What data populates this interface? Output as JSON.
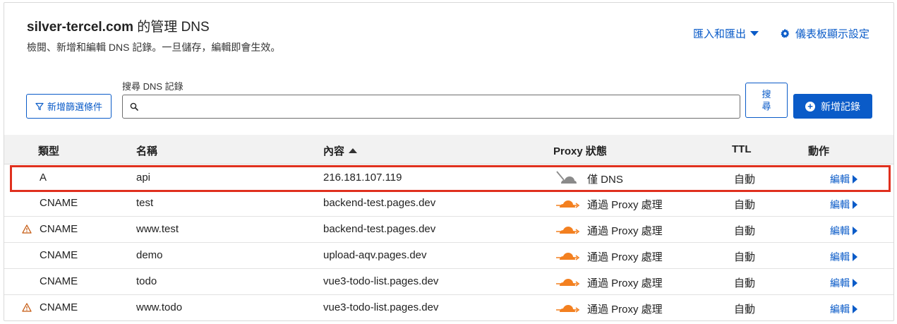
{
  "header": {
    "domain": "silver-tercel.com",
    "title_suffix": " 的管理 DNS",
    "subtitle": "檢閱、新增和編輯 DNS 記錄。一旦儲存，編輯即會生效。",
    "import_export_label": "匯入和匯出",
    "dashboard_settings_label": "儀表板顯示設定"
  },
  "toolbar": {
    "filter_label": "新增篩選條件",
    "search_label": "搜尋 DNS 記錄",
    "search_value": "",
    "search_button_label": "搜尋",
    "add_record_label": "新增記錄"
  },
  "table": {
    "columns": [
      "類型",
      "名稱",
      "內容",
      "Proxy 狀態",
      "TTL",
      "動作"
    ],
    "sorted_column": "內容",
    "rows": [
      {
        "warning": false,
        "type": "A",
        "name": "api",
        "content": "216.181.107.119",
        "proxy": "僅 DNS",
        "proxied": false,
        "ttl": "自動",
        "action": "編輯"
      },
      {
        "warning": false,
        "type": "CNAME",
        "name": "test",
        "content": "backend-test.pages.dev",
        "proxy": "通過 Proxy 處理",
        "proxied": true,
        "ttl": "自動",
        "action": "編輯"
      },
      {
        "warning": true,
        "type": "CNAME",
        "name": "www.test",
        "content": "backend-test.pages.dev",
        "proxy": "通過 Proxy 處理",
        "proxied": true,
        "ttl": "自動",
        "action": "編輯"
      },
      {
        "warning": false,
        "type": "CNAME",
        "name": "demo",
        "content": "upload-aqv.pages.dev",
        "proxy": "通過 Proxy 處理",
        "proxied": true,
        "ttl": "自動",
        "action": "編輯"
      },
      {
        "warning": false,
        "type": "CNAME",
        "name": "todo",
        "content": "vue3-todo-list.pages.dev",
        "proxy": "通過 Proxy 處理",
        "proxied": true,
        "ttl": "自動",
        "action": "編輯"
      },
      {
        "warning": true,
        "type": "CNAME",
        "name": "www.todo",
        "content": "vue3-todo-list.pages.dev",
        "proxy": "通過 Proxy 處理",
        "proxied": true,
        "ttl": "自動",
        "action": "編輯"
      }
    ]
  },
  "colors": {
    "accent": "#0a5bc8",
    "highlight_border": "#e0301e",
    "proxied_cloud": "#f38020",
    "dns_only_cloud": "#8a8a8a",
    "warning": "#c55a11"
  },
  "icons": {
    "import_export": "chevron-down-icon",
    "settings": "gear-icon",
    "filter": "filter-icon",
    "search": "search-icon",
    "add": "plus-circle-icon",
    "sort": "sort-ascending-icon",
    "warning": "warning-icon",
    "proxied": "cloud-proxied-icon",
    "dns_only": "cloud-dns-only-icon",
    "edit": "caret-right-icon"
  }
}
